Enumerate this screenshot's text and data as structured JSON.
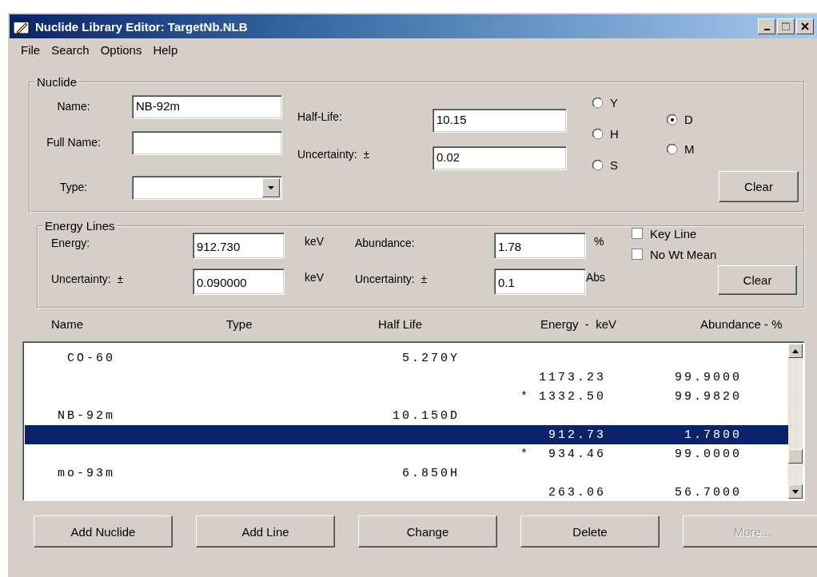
{
  "window": {
    "title": "Nuclide Library Editor: TargetNb.NLB"
  },
  "menu": [
    "File",
    "Search",
    "Options",
    "Help"
  ],
  "nuclide": {
    "title": "Nuclide",
    "name": {
      "label": "Name:",
      "value": "NB-92m"
    },
    "full_name": {
      "label": "Full Name:"
    },
    "type": {
      "label": "Type:"
    },
    "half_life": {
      "label": "Half-Life:",
      "value": "10.15"
    },
    "uncertainty": {
      "label": "Uncertainty:  ±",
      "value": "0.02"
    },
    "units": [
      {
        "label": "Y",
        "selected": false
      },
      {
        "label": "H",
        "selected": false
      },
      {
        "label": "S",
        "selected": false
      },
      {
        "label": "D",
        "selected": true
      },
      {
        "label": "M",
        "selected": false
      }
    ],
    "clear": "Clear"
  },
  "energy_lines": {
    "title": "Energy Lines",
    "energy": {
      "label": "Energy:",
      "value": "912.730",
      "unit": "keV"
    },
    "abundance": {
      "label": "Abundance:",
      "value": "1.78",
      "unit": "%"
    },
    "energy_uncertainty": {
      "label": "Uncertainty:  ±",
      "value": "0.090000",
      "unit": "keV"
    },
    "abundance_uncertainty": {
      "label": "Uncertainty:  ±",
      "value": "0.1",
      "unit": "Abs"
    },
    "options": [
      {
        "label": "Key Line",
        "checked": false
      },
      {
        "label": "No Wt Mean",
        "checked": false
      }
    ],
    "clear": "Clear"
  },
  "list": {
    "columns": [
      "Name",
      "Type",
      "Half Life",
      "Energy  -  keV",
      "Abundance - %"
    ],
    "rows": [
      {
        "name": "CO-60",
        "half_life": "5.270Y",
        "selected": false
      },
      {
        "energy": "1173.23",
        "abundance": "99.9000",
        "selected": false
      },
      {
        "key": "*",
        "energy": "1332.50",
        "abundance": "99.9820",
        "selected": false
      },
      {
        "name": "NB-92m",
        "half_life": "10.150D",
        "selected": false
      },
      {
        "energy": "912.73",
        "abundance": "1.7800",
        "selected": true
      },
      {
        "key": "*",
        "energy": "934.46",
        "abundance": "99.0000",
        "selected": false
      },
      {
        "name": "mo-93m",
        "half_life": "6.850H",
        "selected": false
      },
      {
        "energy": "263.06",
        "abundance": "56.7000",
        "selected": false
      }
    ]
  },
  "buttons": [
    {
      "label": "Add Nuclide",
      "disabled": false
    },
    {
      "label": "Add Line",
      "disabled": false
    },
    {
      "label": "Change",
      "disabled": false
    },
    {
      "label": "Delete",
      "disabled": false
    },
    {
      "label": "More...",
      "disabled": true
    }
  ]
}
